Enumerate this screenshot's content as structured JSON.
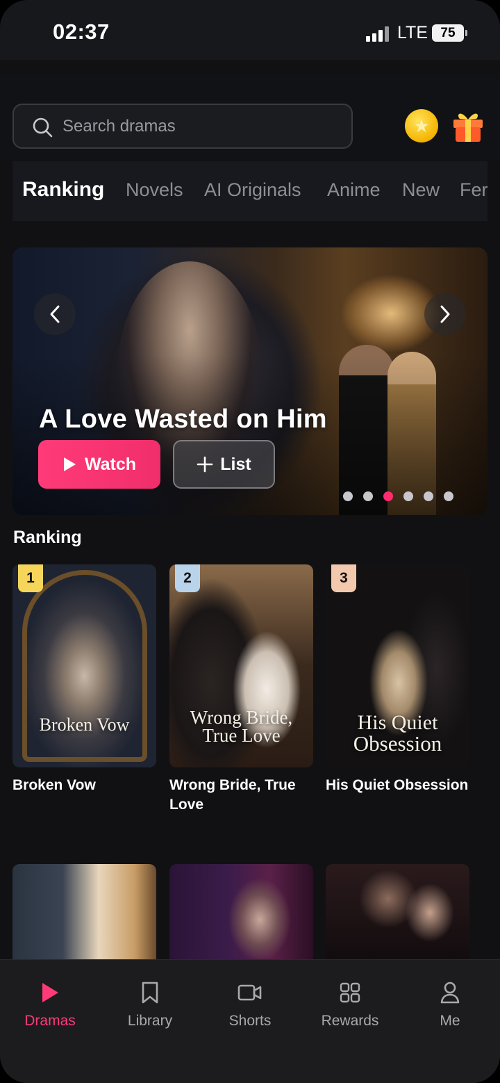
{
  "status_bar": {
    "time": "02:37",
    "network": "LTE",
    "battery": "75"
  },
  "search": {
    "placeholder": "Search dramas"
  },
  "header_icons": [
    "coin-icon",
    "gift-icon"
  ],
  "tabs": [
    {
      "label": "Ranking",
      "active": true
    },
    {
      "label": "Novels"
    },
    {
      "label": "AI Originals"
    },
    {
      "label": "Anime"
    },
    {
      "label": "New"
    },
    {
      "label": "Fer"
    }
  ],
  "hero": {
    "title": "A Love Wasted on Him",
    "watch_label": "Watch",
    "list_label": "List",
    "slides_total": 6,
    "active_slide": 3
  },
  "ranking": {
    "title": "Ranking",
    "items": [
      {
        "rank": "1",
        "title": "Broken Vow",
        "poster_title": "Broken Vow",
        "badge_color": "#f5d55a"
      },
      {
        "rank": "2",
        "title": "Wrong Bride, True Love",
        "poster_title_1": "Wrong Bride,",
        "poster_title_2": "True Love",
        "badge_color": "#b9d3ea"
      },
      {
        "rank": "3",
        "title": "His Quiet Obsession",
        "poster_title_1": "His Quiet",
        "poster_title_2": "Obsession",
        "badge_color": "#f3c9ae"
      }
    ]
  },
  "bottom_nav": [
    {
      "label": "Dramas",
      "icon": "play-icon",
      "active": true
    },
    {
      "label": "Library",
      "icon": "bookmark-icon"
    },
    {
      "label": "Shorts",
      "icon": "video-camera-icon"
    },
    {
      "label": "Rewards",
      "icon": "grid-icon"
    },
    {
      "label": "Me",
      "icon": "user-icon"
    }
  ],
  "colors": {
    "accent": "#ff3a78",
    "background": "#111114"
  }
}
